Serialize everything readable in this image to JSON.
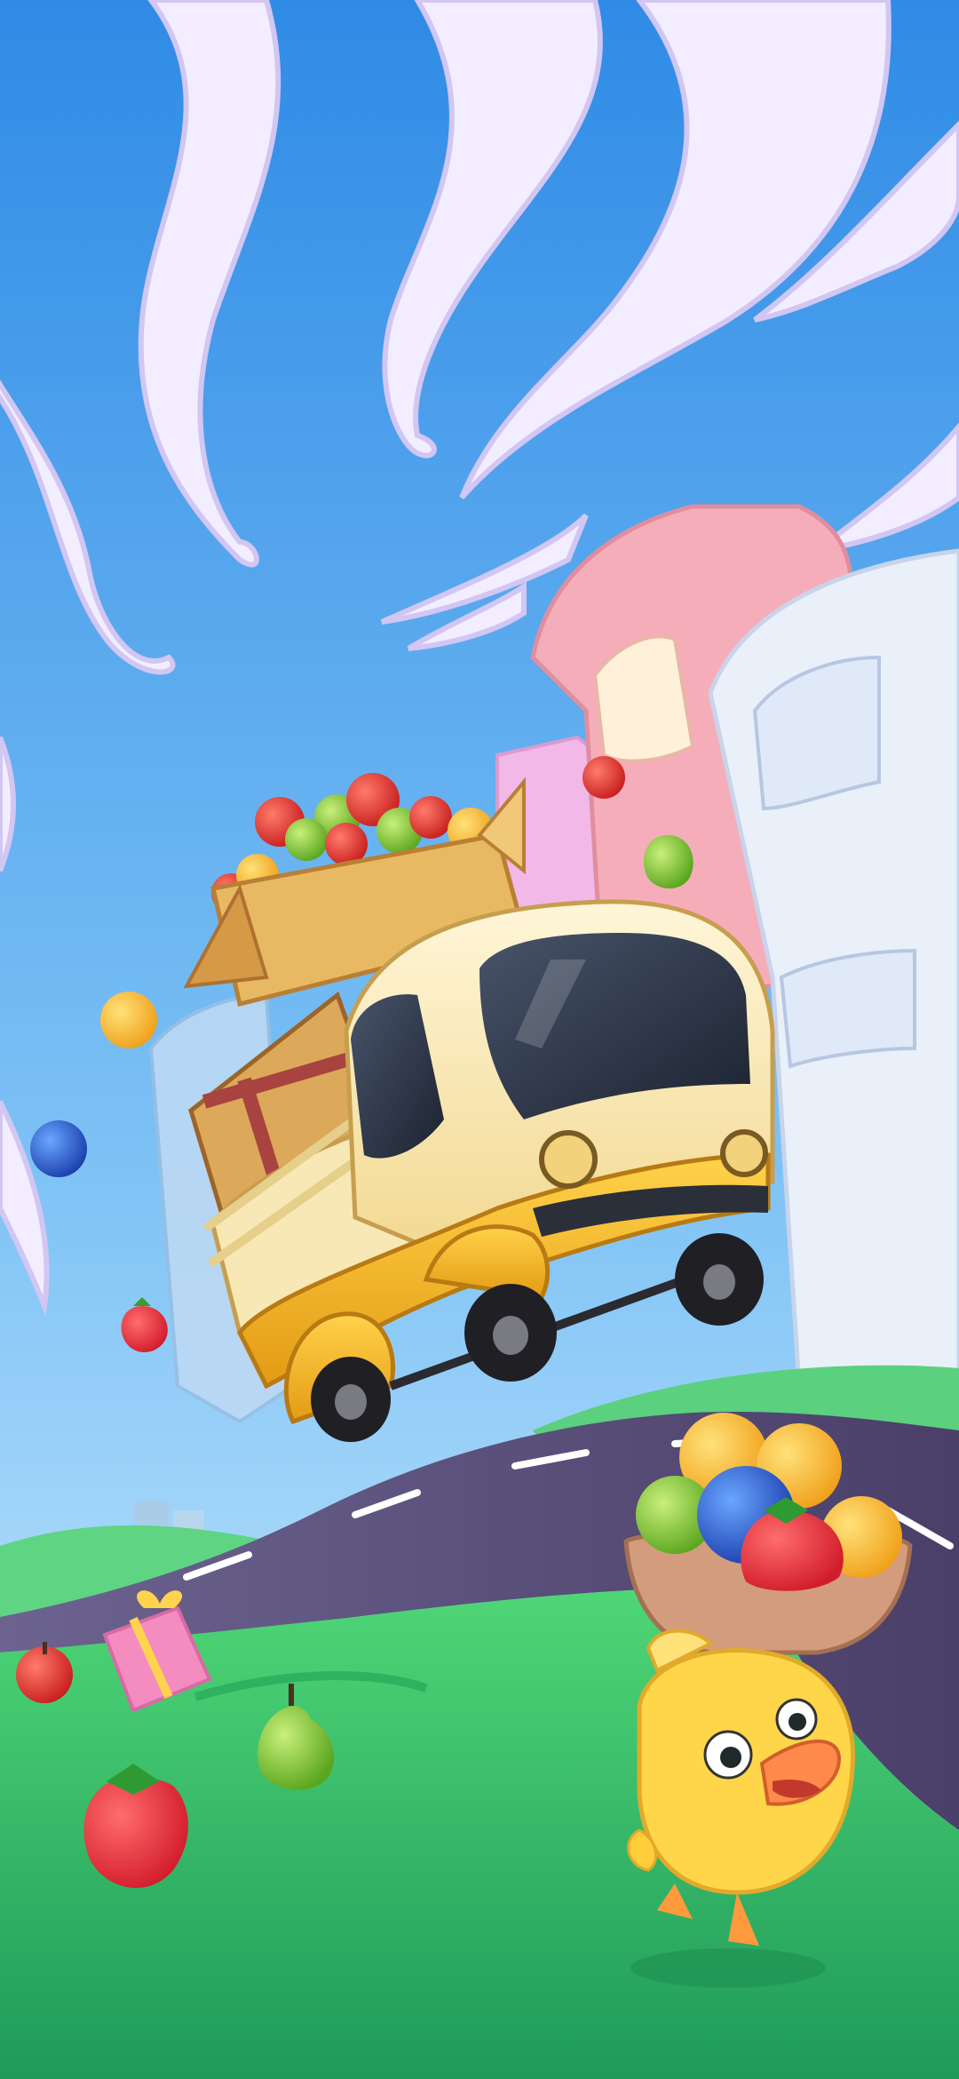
{
  "screen": {
    "type": "game-splash-illustration",
    "text": []
  },
  "scene": {
    "sky": {
      "top_color": "#2f8be6",
      "bottom_color": "#bfe6ff"
    },
    "clouds": {
      "color": "#f3efff",
      "shadow": "#cfc2f0"
    },
    "buildings": [
      {
        "name": "pink-building",
        "color": "#f4a9b6"
      },
      {
        "name": "white-building",
        "color": "#e9eef8"
      },
      {
        "name": "lilac-building",
        "color": "#f3b7e6"
      },
      {
        "name": "blue-building",
        "color": "#b9d8f5"
      }
    ],
    "road": {
      "color": "#5b4f7a",
      "stripe": "#ffffff"
    },
    "grass": {
      "color": "#36c96b",
      "dark": "#22a85a"
    },
    "truck": {
      "body": "#f5b72a",
      "cabin": "#f8e8b6",
      "window": "#2d3440",
      "wheel": "#1f1f24"
    },
    "box": {
      "color": "#e3b35e",
      "ribbon": "#a8433f"
    },
    "chick": {
      "body": "#ffd64a",
      "beak": "#ff8a4c"
    },
    "bowl": {
      "color": "#c98b6b"
    },
    "items": [
      {
        "name": "apple-icon"
      },
      {
        "name": "pear-icon"
      },
      {
        "name": "orange-icon"
      },
      {
        "name": "blueberry-icon"
      },
      {
        "name": "strawberry-icon"
      },
      {
        "name": "gift-icon"
      }
    ]
  }
}
